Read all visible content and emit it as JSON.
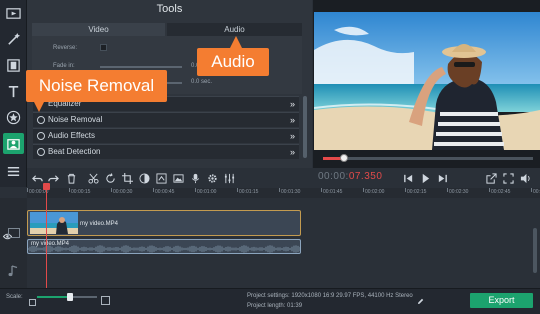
{
  "tools": {
    "title": "Tools",
    "tabs": [
      {
        "label": "Video"
      },
      {
        "label": "Audio"
      }
    ],
    "settings": {
      "reverse_label": "Reverse:",
      "fade_in_label": "Fade in:",
      "fade_in_value": "0.0",
      "fade_out_value": "0.0 sec."
    },
    "effects": [
      {
        "label": "Equalizer"
      },
      {
        "label": "Noise Removal"
      },
      {
        "label": "Audio Effects"
      },
      {
        "label": "Beat Detection"
      }
    ],
    "chevron": "»"
  },
  "callouts": {
    "audio": "Audio",
    "noise_removal": "Noise Removal"
  },
  "preview": {
    "progress": 0.1
  },
  "toolbar": {
    "timecode_prefix": "00:00:",
    "timecode_value": "07.350"
  },
  "ruler": {
    "ticks": [
      "00:00:00",
      "00:00:15",
      "00:00:30",
      "00:00:45",
      "00:01:00",
      "00:01:15",
      "00:01:30",
      "00:01:45",
      "00:02:00",
      "00:02:15",
      "00:02:30",
      "00:02:45",
      "00:03:00"
    ]
  },
  "timeline": {
    "video_clip_label": "my video.MP4",
    "audio_clip_label": "my video.MP4"
  },
  "bottom": {
    "scale_label": "Scale:",
    "scale_level": 0.55,
    "project_settings": "Project settings:  1920x1080 16:9 29.97 FPS, 44100 Hz Stereo",
    "project_length": "Project length:     01:39",
    "export_label": "Export"
  },
  "colors": {
    "accent": "#1ca36e",
    "callout": "#f47d31",
    "timecode_red": "#e24a4a",
    "clip_border": "#c39b50"
  }
}
